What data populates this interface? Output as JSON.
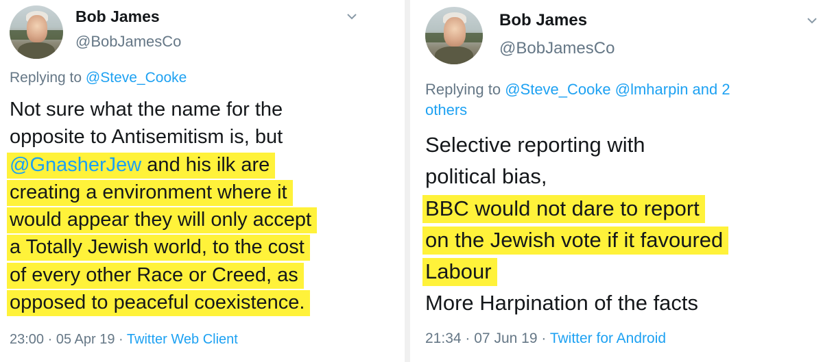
{
  "left_tweet": {
    "display_name": "Bob James",
    "handle": "@BobJamesCo",
    "replying_prefix": "Replying to",
    "replying_to": "@Steve_Cooke",
    "text_line1": "Not sure what the name for the",
    "text_line2": "opposite to Antisemitism is, but",
    "text_mention": "@GnasherJew",
    "text_line3_rest": " and his ilk are",
    "text_line4": "creating a environment where it",
    "text_line5": "would appear they will only accept",
    "text_line6": "a Totally Jewish world, to the cost",
    "text_line7": "of every other Race or Creed, as",
    "text_line8": "opposed to peaceful coexistence.",
    "time": "23:00",
    "date": "05 Apr 19",
    "client": "Twitter Web Client"
  },
  "right_tweet": {
    "display_name": "Bob James",
    "handle": "@BobJamesCo",
    "replying_prefix": "Replying to",
    "replying_to": "@Steve_Cooke @lmharpin and 2",
    "replying_to_cont": "others",
    "text_line1": "Selective reporting with",
    "text_line2": "political bias,",
    "text_line3": "BBC would not dare to report",
    "text_line4": "on the Jewish vote if it favoured",
    "text_line5": "Labour",
    "text_line6": "More Harpination of the facts",
    "time": "21:34",
    "date": "07 Jun 19",
    "client": "Twitter for Android"
  },
  "separator": "·",
  "colors": {
    "highlight": "#fff23a",
    "link": "#1da1f2",
    "muted": "#657786",
    "text": "#14171a"
  }
}
